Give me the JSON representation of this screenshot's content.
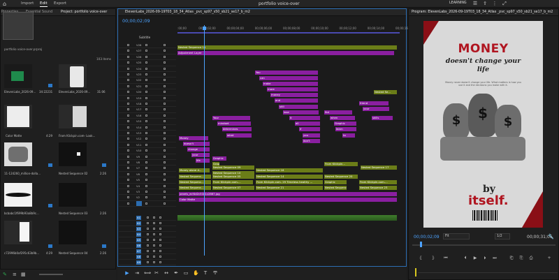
{
  "app": {
    "doc_title": "portfolio voice-over",
    "nav_tabs": [
      "Import",
      "Edit",
      "Export"
    ],
    "active_tab": "Edit",
    "workspace_label": "LEARNING"
  },
  "project_panel": {
    "tabs": [
      "Properties",
      "Essential Sound",
      "Project: portfolio voice-over"
    ],
    "file_name": "portfolio voice-over.prproj",
    "item_count": "103 items",
    "items": [
      {
        "name": "ElevenLabs_2026-09...",
        "dur": "34:22231"
      },
      {
        "name": "ElevenLabs_2026-09...",
        "dur": "31:06"
      },
      {
        "name": "Color Matte",
        "dur": "4:29"
      },
      {
        "name": "From Klickpin.com- Look...",
        "dur": "4:29"
      },
      {
        "name": "11-124260_million-dolla...",
        "dur": "4:29"
      },
      {
        "name": "Nested Sequence 02",
        "dur": "2:26"
      },
      {
        "name": "bcbabc1f699b93a8b9c...",
        "dur": "4:29"
      },
      {
        "name": "Nested Sequence 03",
        "dur": "2:26"
      },
      {
        "name": "c72996b0af295c63b9b...",
        "dur": "4:29"
      },
      {
        "name": "Nested Sequence 04",
        "dur": "2:26"
      }
    ]
  },
  "timeline": {
    "tab_label": "ElevenLabs_2026-09-19T03_18_34_Atlas _pvc_sp97_s50_sb21_se17_b_m2",
    "timecode": "00;00;02;09",
    "subtitle_label": "Subtitle",
    "ruler_ticks": [
      ":00;00",
      "00;00;02;00",
      "00;00;04;00",
      "00;00;06;00",
      "00;00;08;00",
      "00;00;10;00",
      "00;00;12;00",
      "00;00;14;00",
      "00;00;16;00"
    ],
    "video_tracks": [
      "V28",
      "V27",
      "V26",
      "V25",
      "V24",
      "V23",
      "V22",
      "V21",
      "V20",
      "V19",
      "V18",
      "V17",
      "V16",
      "V15",
      "V14",
      "V13",
      "V12",
      "V11",
      "V10",
      "V9",
      "V8",
      "V7",
      "V6",
      "V5",
      "V4",
      "V3",
      "V2",
      "V1"
    ],
    "audio_tracks": [
      "A1",
      "A2",
      "A3",
      "A4",
      "A5",
      "A6",
      "A7",
      "A8",
      "A9"
    ],
    "clips": [
      {
        "label": "Nested Sequence 11",
        "style": "g"
      },
      {
        "label": "Adjustment Layer",
        "style": "v"
      },
      {
        "label": "You",
        "style": "v"
      },
      {
        "label": "can",
        "style": "v"
      },
      {
        "label": "make",
        "style": "v"
      },
      {
        "label": "more",
        "style": "v"
      },
      {
        "label": "money",
        "style": "v"
      },
      {
        "label": "and",
        "style": "v"
      },
      {
        "label": "still",
        "style": "v"
      },
      {
        "label": "lose",
        "style": "v"
      },
      {
        "label": "it",
        "style": "v"
      },
      {
        "label": "all",
        "style": "v"
      },
      {
        "label": "if",
        "style": "v"
      },
      {
        "label": "you",
        "style": "v"
      },
      {
        "label": "don't",
        "style": "v"
      },
      {
        "label": "fkd",
        "style": "v"
      },
      {
        "label": "when",
        "style": "v"
      },
      {
        "label": "Graphic",
        "style": "v"
      },
      {
        "label": "learn",
        "style": "v"
      },
      {
        "label": "to",
        "style": "v"
      },
      {
        "label": "friend",
        "style": "v"
      },
      {
        "label": "your",
        "style": "v"
      },
      {
        "label": "skills",
        "style": "v"
      },
      {
        "label": "Nested Se...",
        "style": "g"
      },
      {
        "label": "Your",
        "style": "v"
      },
      {
        "label": "mindset",
        "style": "v"
      },
      {
        "label": "determines",
        "style": "v"
      },
      {
        "label": "what",
        "style": "v"
      },
      {
        "label": "Money",
        "style": "v"
      },
      {
        "label": "doesn't",
        "style": "v"
      },
      {
        "label": "change",
        "style": "v"
      },
      {
        "label": "your",
        "style": "v"
      },
      {
        "label": "life",
        "style": "v"
      },
      {
        "label": "Graphic",
        "style": "v"
      },
      {
        "label": "Nested Sequence 09",
        "style": "g"
      },
      {
        "label": "Nested Sequence 10",
        "style": "g"
      },
      {
        "label": "Graphic",
        "style": "g"
      },
      {
        "label": "From Klickpin...",
        "style": "g"
      },
      {
        "label": "Nested Sequence 17",
        "style": "g"
      },
      {
        "label": "Money alone d...",
        "style": "g"
      },
      {
        "label": "Nested Sequence 16",
        "style": "g"
      },
      {
        "label": "Nested Sequenc...",
        "style": "g"
      },
      {
        "label": "Nested Sequence 05",
        "style": "g"
      },
      {
        "label": "Nested Sequence 14",
        "style": "g"
      },
      {
        "label": "Nested Sequence 20",
        "style": "g"
      },
      {
        "label": "Nested Sequenc...",
        "style": "g"
      },
      {
        "label": "From Klickpin.com-...",
        "style": "g"
      },
      {
        "label": "From Klickpin.com- 29 Timeless healthy ...",
        "style": "g"
      },
      {
        "label": "Graphic",
        "style": "g"
      },
      {
        "label": "From Klickpin.com-...",
        "style": "g"
      },
      {
        "label": "Nested Sequenc...",
        "style": "g"
      },
      {
        "label": "Nested Sequence 07",
        "style": "g"
      },
      {
        "label": "Nested Sequence 21",
        "style": "g"
      },
      {
        "label": "Nested Sequence 15",
        "style": "g"
      },
      {
        "label": "Nested Sequence 23",
        "style": "g"
      },
      {
        "label": "pexels_ecf4d2c51b1c2867.jpg",
        "style": "v"
      },
      {
        "label": "Color Matte",
        "style": "v"
      }
    ]
  },
  "program_monitor": {
    "title": "Program: ElevenLabs_2026-09-19T03_18_34_Atlas _pvc_sp97_s50_sb21_se17_b_m2",
    "timecode": "00;00;02;09",
    "fit_label": "Fit",
    "resolution": "1/2",
    "duration": "00;00;31;06"
  },
  "poster": {
    "headline": "MONEY",
    "line1": "doesn't change your",
    "line2": "life",
    "body": "Money never doesn't change your life. What matters is how you use it and the decisions you make with it.",
    "by": "by",
    "itself": "itself."
  },
  "colors": {
    "accent_blue": "#4da3ff",
    "clip_purple": "#8a1fa0",
    "clip_green": "#6b7d18",
    "poster_red": "#b01520"
  }
}
